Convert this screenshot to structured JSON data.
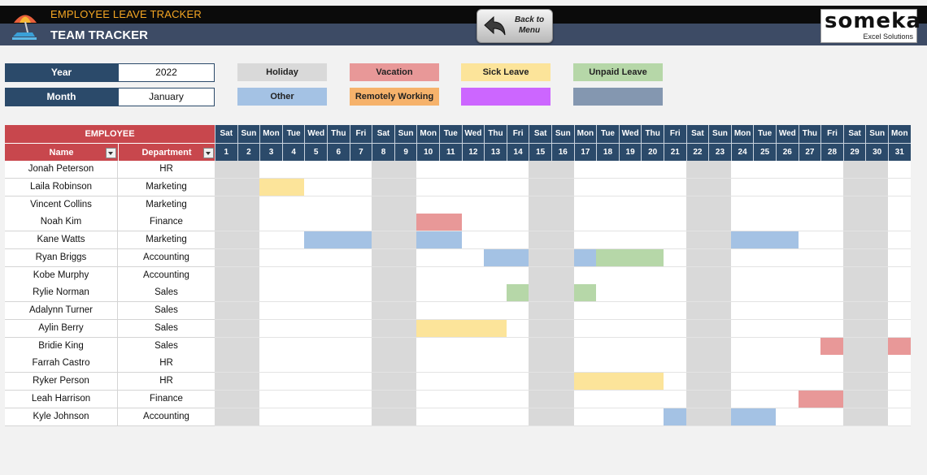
{
  "header": {
    "app_title": "EMPLOYEE LEAVE TRACKER",
    "page_title": "TEAM TRACKER",
    "back_button_label": "Back to\nMenu",
    "brand_name": "someka",
    "brand_sub": "Excel Solutions",
    "icons": {
      "logo": "beach-umbrella-icon",
      "back": "back-arrow-icon"
    }
  },
  "controls": {
    "year_label": "Year",
    "year_value": "2022",
    "month_label": "Month",
    "month_value": "January"
  },
  "legend": [
    {
      "key": "holiday",
      "label": "Holiday",
      "color": "#d9d9d9"
    },
    {
      "key": "vacation",
      "label": "Vacation",
      "color": "#e89898"
    },
    {
      "key": "sick",
      "label": "Sick Leave",
      "color": "#fce49a"
    },
    {
      "key": "unpaid",
      "label": "Unpaid Leave",
      "color": "#b6d7a8"
    },
    {
      "key": "other",
      "label": "Other",
      "color": "#a4c2e4"
    },
    {
      "key": "remote",
      "label": "Remotely Working",
      "color": "#f6b26b"
    },
    {
      "key": "custom1",
      "label": "",
      "color": "#cc66ff"
    },
    {
      "key": "custom2",
      "label": "",
      "color": "#8497b0"
    }
  ],
  "table": {
    "employee_header": "EMPLOYEE",
    "name_header": "Name",
    "department_header": "Department",
    "weekend_color": "#d9d9d9",
    "days": [
      {
        "dow": "Sat",
        "date": "1"
      },
      {
        "dow": "Sun",
        "date": "2"
      },
      {
        "dow": "Mon",
        "date": "3"
      },
      {
        "dow": "Tue",
        "date": "4"
      },
      {
        "dow": "Wed",
        "date": "5"
      },
      {
        "dow": "Thu",
        "date": "6"
      },
      {
        "dow": "Fri",
        "date": "7"
      },
      {
        "dow": "Sat",
        "date": "8"
      },
      {
        "dow": "Sun",
        "date": "9"
      },
      {
        "dow": "Mon",
        "date": "10"
      },
      {
        "dow": "Tue",
        "date": "11"
      },
      {
        "dow": "Wed",
        "date": "12"
      },
      {
        "dow": "Thu",
        "date": "13"
      },
      {
        "dow": "Fri",
        "date": "14"
      },
      {
        "dow": "Sat",
        "date": "15"
      },
      {
        "dow": "Sun",
        "date": "16"
      },
      {
        "dow": "Mon",
        "date": "17"
      },
      {
        "dow": "Tue",
        "date": "18"
      },
      {
        "dow": "Wed",
        "date": "19"
      },
      {
        "dow": "Thu",
        "date": "20"
      },
      {
        "dow": "Fri",
        "date": "21"
      },
      {
        "dow": "Sat",
        "date": "22"
      },
      {
        "dow": "Sun",
        "date": "23"
      },
      {
        "dow": "Mon",
        "date": "24"
      },
      {
        "dow": "Tue",
        "date": "25"
      },
      {
        "dow": "Wed",
        "date": "26"
      },
      {
        "dow": "Thu",
        "date": "27"
      },
      {
        "dow": "Fri",
        "date": "28"
      },
      {
        "dow": "Sat",
        "date": "29"
      },
      {
        "dow": "Sun",
        "date": "30"
      },
      {
        "dow": "Mon",
        "date": "31"
      }
    ],
    "employees": [
      {
        "name": "Jonah Peterson",
        "department": "HR",
        "leaves": []
      },
      {
        "name": "Laila Robinson",
        "department": "Marketing",
        "leaves": [
          {
            "from": 3,
            "to": 4,
            "type": "sick"
          }
        ]
      },
      {
        "name": "Vincent Collins",
        "department": "Marketing",
        "leaves": []
      },
      {
        "name": "Noah Kim",
        "department": "Finance",
        "leaves": [
          {
            "from": 10,
            "to": 11,
            "type": "vacation"
          }
        ]
      },
      {
        "name": "Kane Watts",
        "department": "Marketing",
        "leaves": [
          {
            "from": 5,
            "to": 7,
            "type": "other"
          },
          {
            "from": 10,
            "to": 11,
            "type": "other"
          },
          {
            "from": 24,
            "to": 26,
            "type": "other"
          }
        ]
      },
      {
        "name": "Ryan Briggs",
        "department": "Accounting",
        "leaves": [
          {
            "from": 13,
            "to": 14,
            "type": "other"
          },
          {
            "from": 17,
            "to": 17,
            "type": "other"
          },
          {
            "from": 18,
            "to": 20,
            "type": "unpaid"
          }
        ]
      },
      {
        "name": "Kobe Murphy",
        "department": "Accounting",
        "leaves": []
      },
      {
        "name": "Rylie Norman",
        "department": "Sales",
        "leaves": [
          {
            "from": 14,
            "to": 14,
            "type": "unpaid"
          },
          {
            "from": 17,
            "to": 17,
            "type": "unpaid"
          }
        ]
      },
      {
        "name": "Adalynn Turner",
        "department": "Sales",
        "leaves": []
      },
      {
        "name": "Aylin Berry",
        "department": "Sales",
        "leaves": [
          {
            "from": 10,
            "to": 13,
            "type": "sick"
          }
        ]
      },
      {
        "name": "Bridie King",
        "department": "Sales",
        "leaves": [
          {
            "from": 28,
            "to": 28,
            "type": "vacation"
          },
          {
            "from": 31,
            "to": 31,
            "type": "vacation"
          }
        ]
      },
      {
        "name": "Farrah Castro",
        "department": "HR",
        "leaves": []
      },
      {
        "name": "Ryker Person",
        "department": "HR",
        "leaves": [
          {
            "from": 17,
            "to": 20,
            "type": "sick"
          }
        ]
      },
      {
        "name": "Leah Harrison",
        "department": "Finance",
        "leaves": [
          {
            "from": 27,
            "to": 28,
            "type": "vacation"
          }
        ]
      },
      {
        "name": "Kyle Johnson",
        "department": "Accounting",
        "leaves": [
          {
            "from": 21,
            "to": 21,
            "type": "other"
          },
          {
            "from": 24,
            "to": 25,
            "type": "other"
          }
        ]
      }
    ]
  }
}
